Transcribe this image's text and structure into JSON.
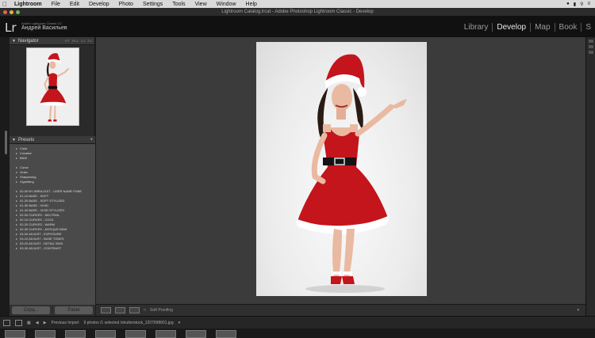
{
  "menubar": {
    "app": "Lightroom",
    "items": [
      "File",
      "Edit",
      "Develop",
      "Photo",
      "Settings",
      "Tools",
      "View",
      "Window",
      "Help"
    ]
  },
  "window": {
    "title": "Lightroom Catalog.lrcat - Adobe Photoshop Lightroom Classic - Develop"
  },
  "identity": {
    "logo": "Lr",
    "product": "Adobe Lightroom Classic CC",
    "user": "Андрей Васильев"
  },
  "modules": [
    "Library",
    "Develop",
    "Map",
    "Book",
    "S"
  ],
  "active_module": "Develop",
  "navigator": {
    "title": "Navigator",
    "zoom": [
      "FIT",
      "FILL",
      "1:1",
      "3:1"
    ]
  },
  "presets": {
    "title": "Presets",
    "group1": [
      "Color",
      "Creative",
      "B&W"
    ],
    "group2": [
      "Curve",
      "Grain",
      "Sharpening",
      "Vignetting"
    ],
    "group3": [
      "00-00 BY ARBILOGIT - USER NAME FUNE",
      "01-10 BASE - SOFT",
      "01-20 BASE - SOFT STYLIZED",
      "01-30 BASE - VIVID",
      "01-40 BASE - VIVID STYLIZED",
      "02-00 CURVES - NEUTRAL",
      "02-10 CURVES - COOL",
      "02-20 CURVES - WARM",
      "02-30 CURVES - ANTIQUE B&W",
      "03-00 ADJUST - EXPOSURE",
      "03-10 ADJUST - BASE TONES",
      "03-20 ADJUST - DETAIL SKIN",
      "03-30 ADJUST - CONTRAST"
    ]
  },
  "buttons": {
    "copy": "Copy...",
    "paste": "Paste"
  },
  "toolbar": {
    "soft_proofing": "Soft Proofing"
  },
  "filmstrip": {
    "source": "Previous Import",
    "info": "9 photos /1 selected /shutterstock_1207698601.jpg",
    "pages": [
      "1",
      "2"
    ]
  },
  "colors": {
    "accent": "#3cc13a",
    "dress": "#c4141c"
  }
}
